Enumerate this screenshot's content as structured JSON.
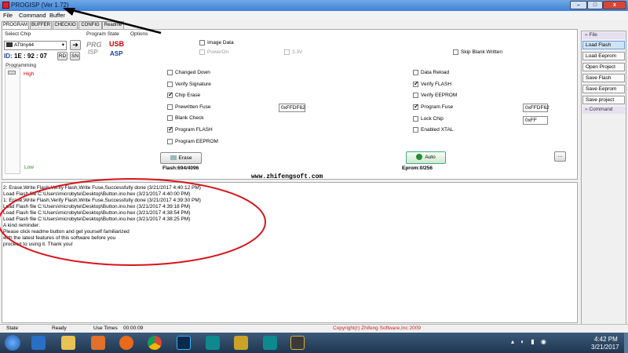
{
  "window": {
    "title": "PROGISP (Ver 1.72)",
    "minimize": "–",
    "maximize": "□",
    "close": "x"
  },
  "menu": [
    "File",
    "Command",
    "Buffer"
  ],
  "tabs": [
    "PROGRAM",
    "BUFFER",
    "CHECKIO",
    "CONFIG",
    "Readme"
  ],
  "select_chip": {
    "label": "Select Chip",
    "value": "ATtiny44",
    "id_label": "ID:",
    "id_value": "1E : 92 : 07",
    "rd": "RD",
    "sn": "SN"
  },
  "program_state": {
    "label": "Program State",
    "prg": "PRG",
    "isp": "ISP",
    "usb": "USB",
    "asp": "ASP",
    "options_label": "Options"
  },
  "options_row1": [
    {
      "label": "Image Data",
      "checked": false,
      "disabled": false
    },
    {
      "label": "PowerOn",
      "checked": false,
      "disabled": true
    },
    {
      "label": "3.3V",
      "checked": false,
      "disabled": true
    },
    {
      "label": "Skip Blank Written",
      "checked": false,
      "disabled": false
    }
  ],
  "programming": {
    "label": "Programming",
    "high": "High",
    "low": "Low"
  },
  "left_options": [
    {
      "label": "Changed Down",
      "checked": false
    },
    {
      "label": "Verify Signature",
      "checked": false
    },
    {
      "label": "Chip Erase",
      "checked": true
    },
    {
      "label": "Prewritten Fuse",
      "checked": false
    },
    {
      "label": "Blank Check",
      "checked": false
    },
    {
      "label": "Program FLASH",
      "checked": true
    },
    {
      "label": "Program EEPROM",
      "checked": false
    }
  ],
  "right_options": [
    {
      "label": "Data Reload",
      "checked": false
    },
    {
      "label": "Verify FLASH",
      "checked": true
    },
    {
      "label": "Verify EEPROM",
      "checked": false
    },
    {
      "label": "Program Fuse",
      "checked": true
    },
    {
      "label": "Lock Chip",
      "checked": false
    },
    {
      "label": "Enabled XTAL",
      "checked": false
    }
  ],
  "fuse_values": {
    "prewritten": "0xFFDF62",
    "program": "0xFFDF62",
    "lock": "0xFF"
  },
  "buttons": {
    "erase": "Erase",
    "auto": "Auto",
    "more": "..."
  },
  "flash_info": "Flash:694/4096",
  "eprom_info": "Eprom:0/256",
  "website": "www.zhifengsoft.com",
  "side": {
    "file_header": "File",
    "items": [
      "Load Flash",
      "Load Eeprom",
      "Open Project",
      "Save Flash",
      "Save Eeprom",
      "Save project"
    ],
    "command_header": "Command"
  },
  "log": [
    "2: Erase,Write Flash,Verify Flash,Write Fuse,Successfully done (3/21/2017 4:40:12 PM)",
    "Load Flash file C:\\Users\\microbyte\\Desktop\\Button.ino.hex (3/21/2017 4:40:00 PM)",
    "1: Erase,Write Flash,Verify Flash,Write Fuse,Successfully done (3/21/2017 4:39:30 PM)",
    "Load Flash file C:\\Users\\microbyte\\Desktop\\Button.ino.hex (3/21/2017 4:39:18 PM)",
    "Load Flash file C:\\Users\\microbyte\\Desktop\\Button.ino.hex (3/21/2017 4:38:54 PM)",
    "Load Flash file C:\\Users\\microbyte\\Desktop\\Button.ino.hex (3/21/2017 4:38:25 PM)",
    "A kind reminder:",
    "Please click readme button and get yourself familiarized",
    "with the latest features of this software before you",
    "proceed to using it. Thank you!"
  ],
  "status": {
    "state_label": "State",
    "state_value": "Ready",
    "use_times_label": "Use Times",
    "use_times_value": "00:00:09",
    "copyright": "Copyright(r) Zhifeng Software,Inc 2009"
  },
  "taskbar": {
    "time": "4:42 PM",
    "date": "3/21/2017"
  },
  "colors": {
    "accent": "#3f82d6",
    "annotation": "#d9141b",
    "copyright": "#cc2222",
    "website": "#c8102e"
  }
}
